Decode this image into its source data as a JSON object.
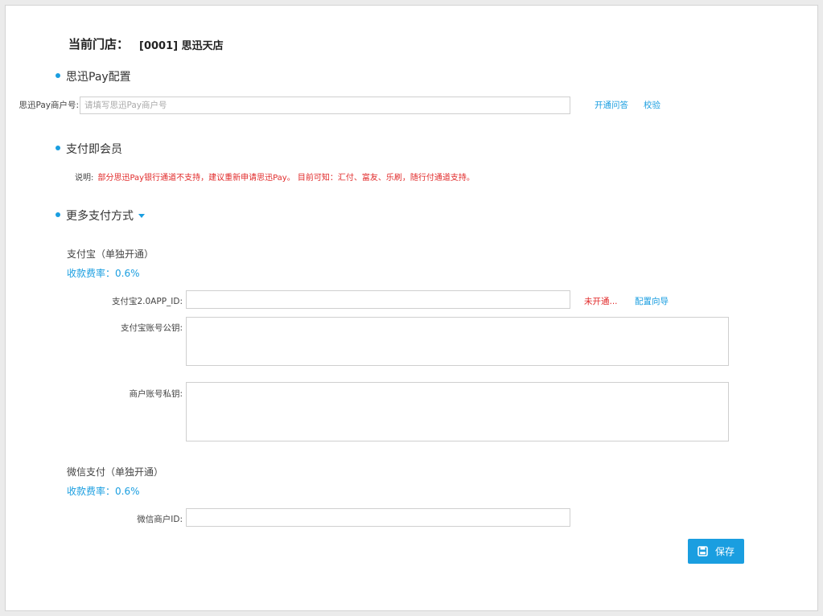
{
  "store": {
    "label": "当前门店：",
    "value": "[0001] 思迅天店"
  },
  "pay_section": {
    "title": "思迅Pay配置",
    "merchant_label": "思迅Pay商户号:",
    "merchant_placeholder": "请填写思迅Pay商户号",
    "links": [
      "开通问答",
      "校验"
    ]
  },
  "member_section": {
    "title": "支付即会员",
    "note_label": "说明:",
    "note_text": "部分思迅Pay银行通道不支持，建议重新申请思迅Pay。 目前可知：汇付、富友、乐刷，随行付通道支持。"
  },
  "more_section": {
    "title": "更多支付方式"
  },
  "alipay": {
    "title": "支付宝（单独开通）",
    "rate": "收款费率：0.6%",
    "app_id_label": "支付宝2.0APP_ID:",
    "status": "未开通...",
    "guide_link": "配置向导",
    "public_key_label": "支付宝账号公钥:",
    "private_key_label": "商户账号私钥:"
  },
  "wechat": {
    "title": "微信支付（单独开通）",
    "rate": "收款费率：0.6%",
    "merchant_label": "微信商户ID:"
  },
  "actions": {
    "save": "保存",
    "save_icon": "floppy-disk-icon"
  },
  "colors": {
    "accent": "#1a9ee0",
    "warning": "#e12a2a",
    "background": "#ebebeb"
  }
}
